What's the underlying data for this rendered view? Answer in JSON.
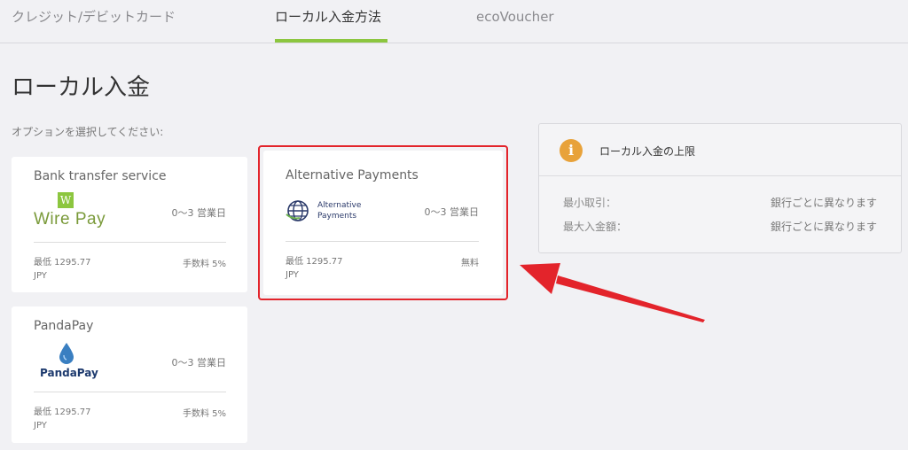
{
  "tabs": [
    {
      "label": "クレジット/デビットカード"
    },
    {
      "label": "ローカル入金方法"
    },
    {
      "label": "ecoVoucher"
    }
  ],
  "page_title": "ローカル入金",
  "subtitle": "オプションを選択してください:",
  "cards": [
    {
      "name": "Bank transfer service",
      "logo_text": "Wire Pay",
      "logo_mark": "W",
      "days": "0〜3 営業日",
      "min_label": "最低 1295.77",
      "currency": "JPY",
      "fee": "手数料 5%"
    },
    {
      "name": "Alternative Payments",
      "logo_text_line1": "Alternative",
      "logo_text_line2": "Payments",
      "days": "0〜3 営業日",
      "min_label": "最低 1295.77",
      "currency": "JPY",
      "fee": "無料"
    },
    {
      "name": "PandaPay",
      "logo_text": "PandaPay",
      "days": "0〜3 営業日",
      "min_label": "最低 1295.77",
      "currency": "JPY",
      "fee": "手数料 5%"
    }
  ],
  "info": {
    "icon": "i",
    "title": "ローカル入金の上限",
    "rows": [
      {
        "label": "最小取引：",
        "value": "銀行ごとに異なります"
      },
      {
        "label": "最大入金額：",
        "value": "銀行ごとに異なります"
      }
    ]
  },
  "colors": {
    "accent": "#8cc63f",
    "highlight": "#e3242b",
    "info_icon": "#e8a23a"
  }
}
